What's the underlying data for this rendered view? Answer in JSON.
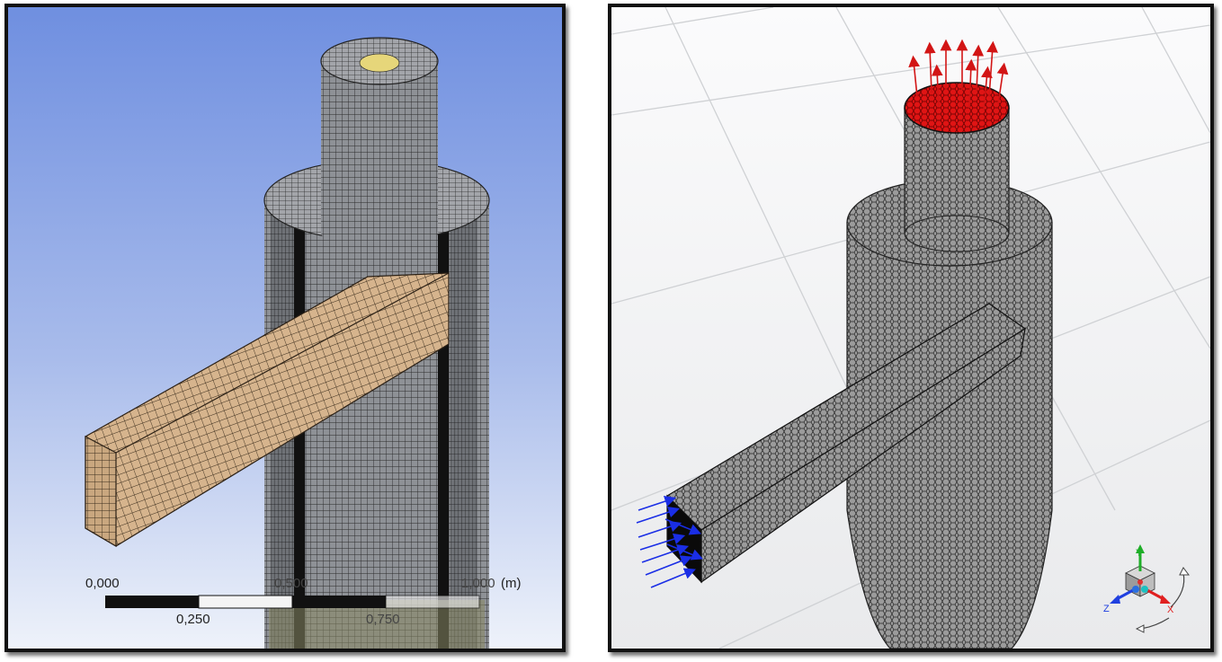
{
  "left_viewport": {
    "scale_bar": {
      "label_zero": "0,000",
      "label_quarter": "0,250",
      "label_half": "0,500",
      "label_three_quarter": "0,750",
      "label_end": "1,000",
      "unit": "(m)"
    },
    "colors": {
      "background_top": "#6f8fe0",
      "background_bottom": "#e6edf9",
      "mesh_body": "#8d9096",
      "inlet_face": "#d4b48e",
      "outlet_face": "#e6d67a"
    }
  },
  "right_viewport": {
    "triad": {
      "x_label": "X",
      "y_label": "Y",
      "z_label": "Z"
    },
    "colors": {
      "outlet_vectors": "#d21515",
      "inlet_vectors": "#1a2ee6",
      "mesh_body": "#9a9a9a",
      "background": "#f2f3f5"
    }
  }
}
